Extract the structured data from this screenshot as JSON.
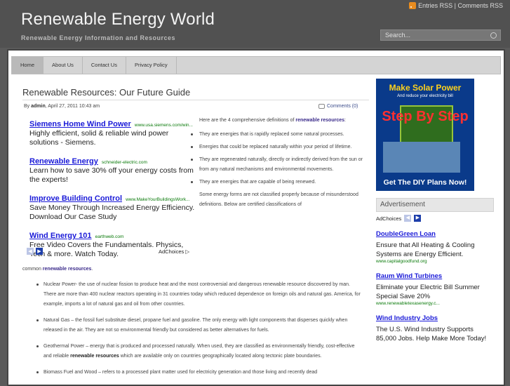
{
  "header": {
    "title": "Renewable Energy World",
    "tagline": "Renewable Energy Information and Resources",
    "rss": "Entries RSS | Comments RSS",
    "search_placeholder": "Search..."
  },
  "nav": [
    "Home",
    "About Us",
    "Contact Us",
    "Privacy Policy"
  ],
  "post": {
    "title": "Renewable Resources: Our Future Guide",
    "meta_by": "By",
    "meta_author": "admin",
    "meta_date": ", April 27, 2011 10:43 am",
    "comments": "Comments (0)"
  },
  "ads": [
    {
      "title": "Siemens Home Wind Power",
      "url": "www.usa.siemens.com/win...",
      "desc": "Highly efficient, solid & reliable wind power solutions - Siemens."
    },
    {
      "title": "Renewable Energy",
      "url": "schneider-electric.com",
      "desc": "Learn how to save 30% off your energy costs from the experts!"
    },
    {
      "title": "Improve Building Control",
      "url": "www.MakeYourBuildingsWork...",
      "desc": "Save Money Through Increased Energy Efficiency. Download Our Case Study"
    },
    {
      "title": "Wind Energy 101",
      "url": "earthweb.com",
      "desc": "Free Video Covers the Fundamentals. Physics, Tech & more. Watch Today."
    }
  ],
  "adchoices": "AdChoices",
  "right_text": {
    "intro_a": "Here are the 4 comprehensive definitions of ",
    "intro_kw": "renewable resources",
    "intro_b": ":",
    "items": [
      "They are energies that is rapidly replaced some natural processes.",
      "Energies that could be replaced naturally within your period of lifetime.",
      "They are regenerated naturally, directly or indirectly derived from the sun or from any natural mechanisms and environmental movements.",
      "They are energies that are capable of being renewed."
    ],
    "para": "Some energy forms are not classified properly because of misunderstood definitions. Below are certified classifications of"
  },
  "body": {
    "lead_a": "common ",
    "lead_kw": "renewable resources",
    "lead_b": ".",
    "items": [
      {
        "a": "Nuclear Power- the use of nuclear fission to produce heat and the most controversial and dangerous renewable resource discovered by man. There are more than 400 nuclear reactors operating in 31 countries today which reduced dependence on foreign oils and natural gas. America, for example, imports a lot of natural gas and oil from other countries.",
        "kw": "",
        "b": ""
      },
      {
        "a": "Natural Gas – the fossil fuel substitute diesel, propane fuel and gasoline. The only energy with light components that disperses quickly when released in the air. They are not so environmental friendly but considered as better alternatives for fuels.",
        "kw": "",
        "b": ""
      },
      {
        "a": "Geothermal Power – energy that is produced and processed naturally. When used, they are classified as environmentally friendly, cost-effective and reliable ",
        "kw": "renewable resources",
        "b": " which are available only on countries geographically located along tectonic plate boundaries."
      },
      {
        "a": "Biomass Fuel and Wood – refers to a processed plant matter used for electricity generation and those living and recently dead",
        "kw": "",
        "b": ""
      }
    ]
  },
  "sidebar": {
    "banner_line1": "Make Solar Power",
    "banner_line2": "And reduce your electricity bill",
    "banner_line3": "Step By Step",
    "banner_line4": "Get The DIY Plans Now!",
    "advert_heading": "Advertisement",
    "adchoices": "AdChoices",
    "ads": [
      {
        "title": "DoubleGreen Loan",
        "desc": "Ensure that All Heating & Cooling Systems are Energy Efficient.",
        "url": "www.capitalgoodfund.org"
      },
      {
        "title": "Raum Wind Turbines",
        "desc": "Eliminate your Electric Bill Summer Special Save 20%",
        "url": "www.renewabletexasenergy.c..."
      },
      {
        "title": "Wind Industry Jobs",
        "desc": "The U.S. Wind Industry Supports 85,000 Jobs. Help Make More Today!",
        "url": ""
      }
    ]
  }
}
